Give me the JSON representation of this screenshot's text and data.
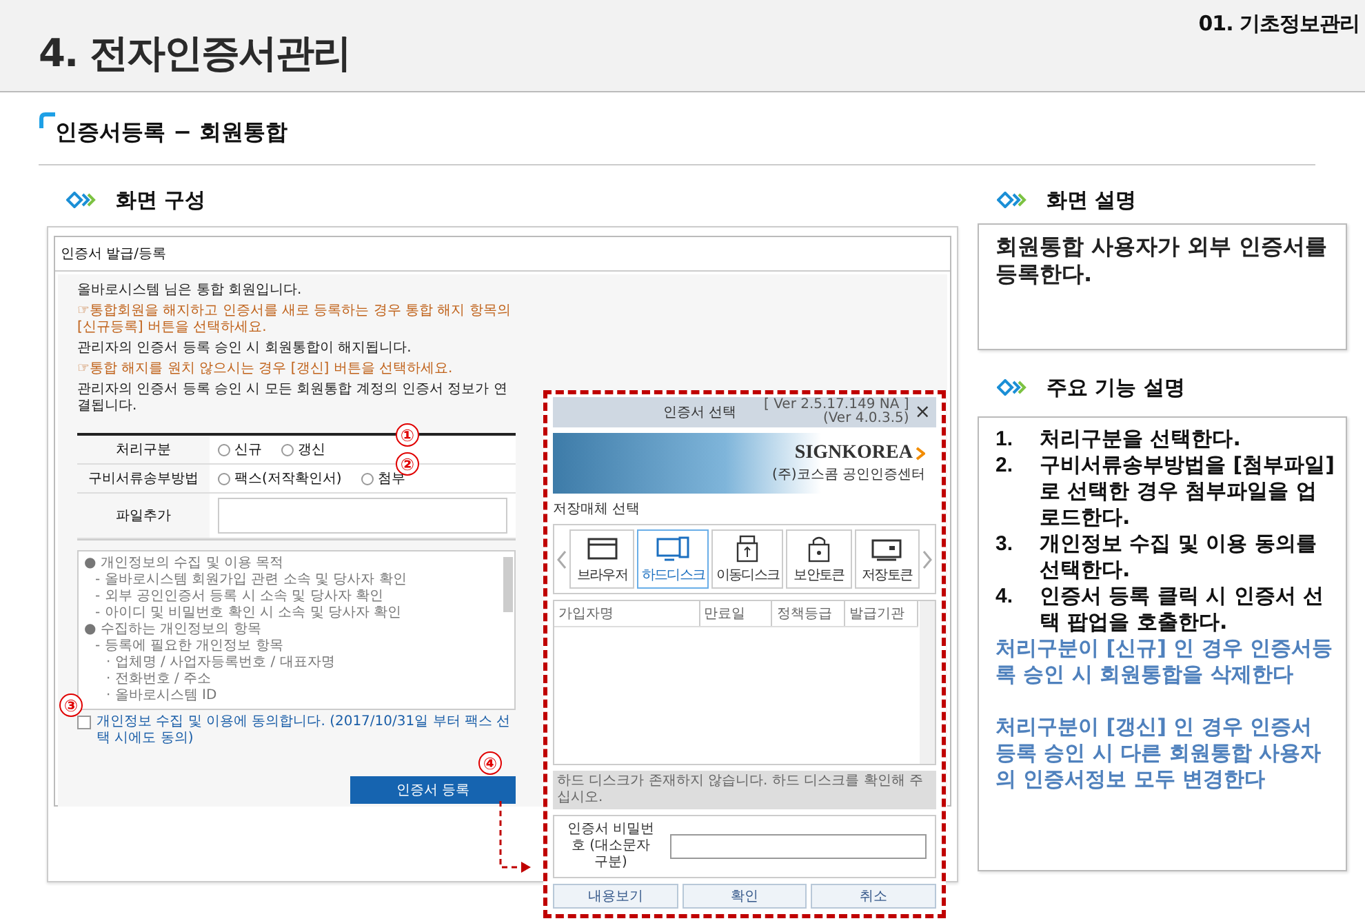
{
  "header": {
    "title": "4. 전자인증서관리",
    "chapter": "01. 기초정보관리"
  },
  "subtitle": "인증서등록 − 회원통합",
  "left_section": {
    "heading": "화면 구성"
  },
  "screen": {
    "window_title": "인증서 발급/등록",
    "notices": [
      {
        "kind": "info",
        "text": "올바로시스템 님은 통합 회원입니다."
      },
      {
        "kind": "hint",
        "text": "☞통합회원을 해지하고 인증서를 새로 등록하는 경우 통합 해지 항목의 [신규등록] 버튼을 선택하세요."
      },
      {
        "kind": "info",
        "text": "관리자의 인증서 등록 승인 시 회원통합이 해지됩니다."
      },
      {
        "kind": "hint",
        "text": "☞통합 해지를 원치 않으시는 경우 [갱신] 버튼을 선택하세요."
      },
      {
        "kind": "info",
        "text": "관리자의 인증서 등록 승인 시 모든 회원통합 계정의 인증서 정보가 연결됩니다."
      }
    ],
    "form": [
      {
        "kind": "radios",
        "label": "처리구분",
        "callout": "①",
        "options": [
          {
            "label": "신규",
            "checked": false
          },
          {
            "label": "갱신",
            "checked": false
          }
        ]
      },
      {
        "kind": "radios",
        "label": "구비서류송부방법",
        "callout": "②",
        "options": [
          {
            "label": "팩스(저작확인서)",
            "checked": false
          },
          {
            "label": "첨부",
            "checked": false
          }
        ]
      },
      {
        "kind": "file",
        "label": "파일추가"
      }
    ],
    "consent": {
      "callout": "③",
      "lines": [
        {
          "text": "● 개인정보의 수집 및 이용 목적",
          "children": [
            {
              "text": "- 올바로시스템 회원가입 관련 소속 및 당사자 확인"
            },
            {
              "text": "- 외부 공인인증서 등록 시 소속 및 당사자 확인"
            },
            {
              "text": "- 아이디 및 비밀번호 확인 시 소속 및 당사자 확인"
            }
          ]
        },
        {
          "text": "● 수집하는 개인정보의 항목",
          "children": [
            {
              "text": "- 등록에 필요한 개인정보 항목",
              "children": [
                {
                  "text": "· 업체명 / 사업자등록번호 / 대표자명"
                },
                {
                  "text": "· 전화번호 / 주소"
                },
                {
                  "text": "· 올바로시스템 ID"
                }
              ]
            }
          ]
        }
      ],
      "checked": false,
      "label": "개인정보 수집 및 이용에 동의합니다. (2017/10/31일 부터 팩스 선택 시에도 동의)"
    },
    "register_button": {
      "label": "인증서 등록",
      "callout": "④"
    }
  },
  "popup": {
    "title": "인증서 선택",
    "version": "[ Ver 2.5.17.149 NA ]",
    "version_sub": "(Ver 4.0.3.5)",
    "close": "×",
    "logo": "SIGNKOREA",
    "logo_sub": "(주)코스콤 공인인증센터",
    "media_heading": "저장매체 선택",
    "media": [
      {
        "kind": "browser",
        "label": "브라우저",
        "selected": false
      },
      {
        "kind": "harddisk",
        "label": "하드디스크",
        "selected": true
      },
      {
        "kind": "usb",
        "label": "이동디스크",
        "selected": false
      },
      {
        "kind": "token",
        "label": "보안토큰",
        "selected": false
      },
      {
        "kind": "card",
        "label": "저장토큰",
        "selected": false
      }
    ],
    "columns": [
      "가입자명",
      "만료일",
      "정책등급",
      "발급기관"
    ],
    "status": "하드 디스크가 존재하지 않습니다. 하드 디스크를 확인해 주십시오.",
    "password_label": "인증서 비밀번호 (대소문자 구분)",
    "buttons": [
      "내용보기",
      "확인",
      "취소"
    ]
  },
  "right": {
    "description": {
      "heading": "화면 설명",
      "text": "회원통합 사용자가 외부 인증서를 등록한다."
    },
    "features": {
      "heading": "주요 기능 설명",
      "steps": [
        {
          "number": "1.",
          "text": "처리구분을 선택한다."
        },
        {
          "number": "2.",
          "text": "구비서류송부방법을 [첨부파일] 로 선택한 경우 첨부파일을 업로드한다."
        },
        {
          "number": "3.",
          "text": "개인정보 수집 및 이용 동의를 선택한다."
        },
        {
          "number": "4.",
          "text": "인증서 등록 클릭 시 인증서 선택 팝업을 호출한다."
        }
      ],
      "notes": [
        "처리구분이 [신규] 인 경우 인증서등록 승인 시 회원통합을 삭제한다",
        "처리구분이 [갱신] 인 경우 인증서 등록 승인 시 다른 회원통합 사용자의 인증서정보 모두 변경한다"
      ]
    }
  }
}
